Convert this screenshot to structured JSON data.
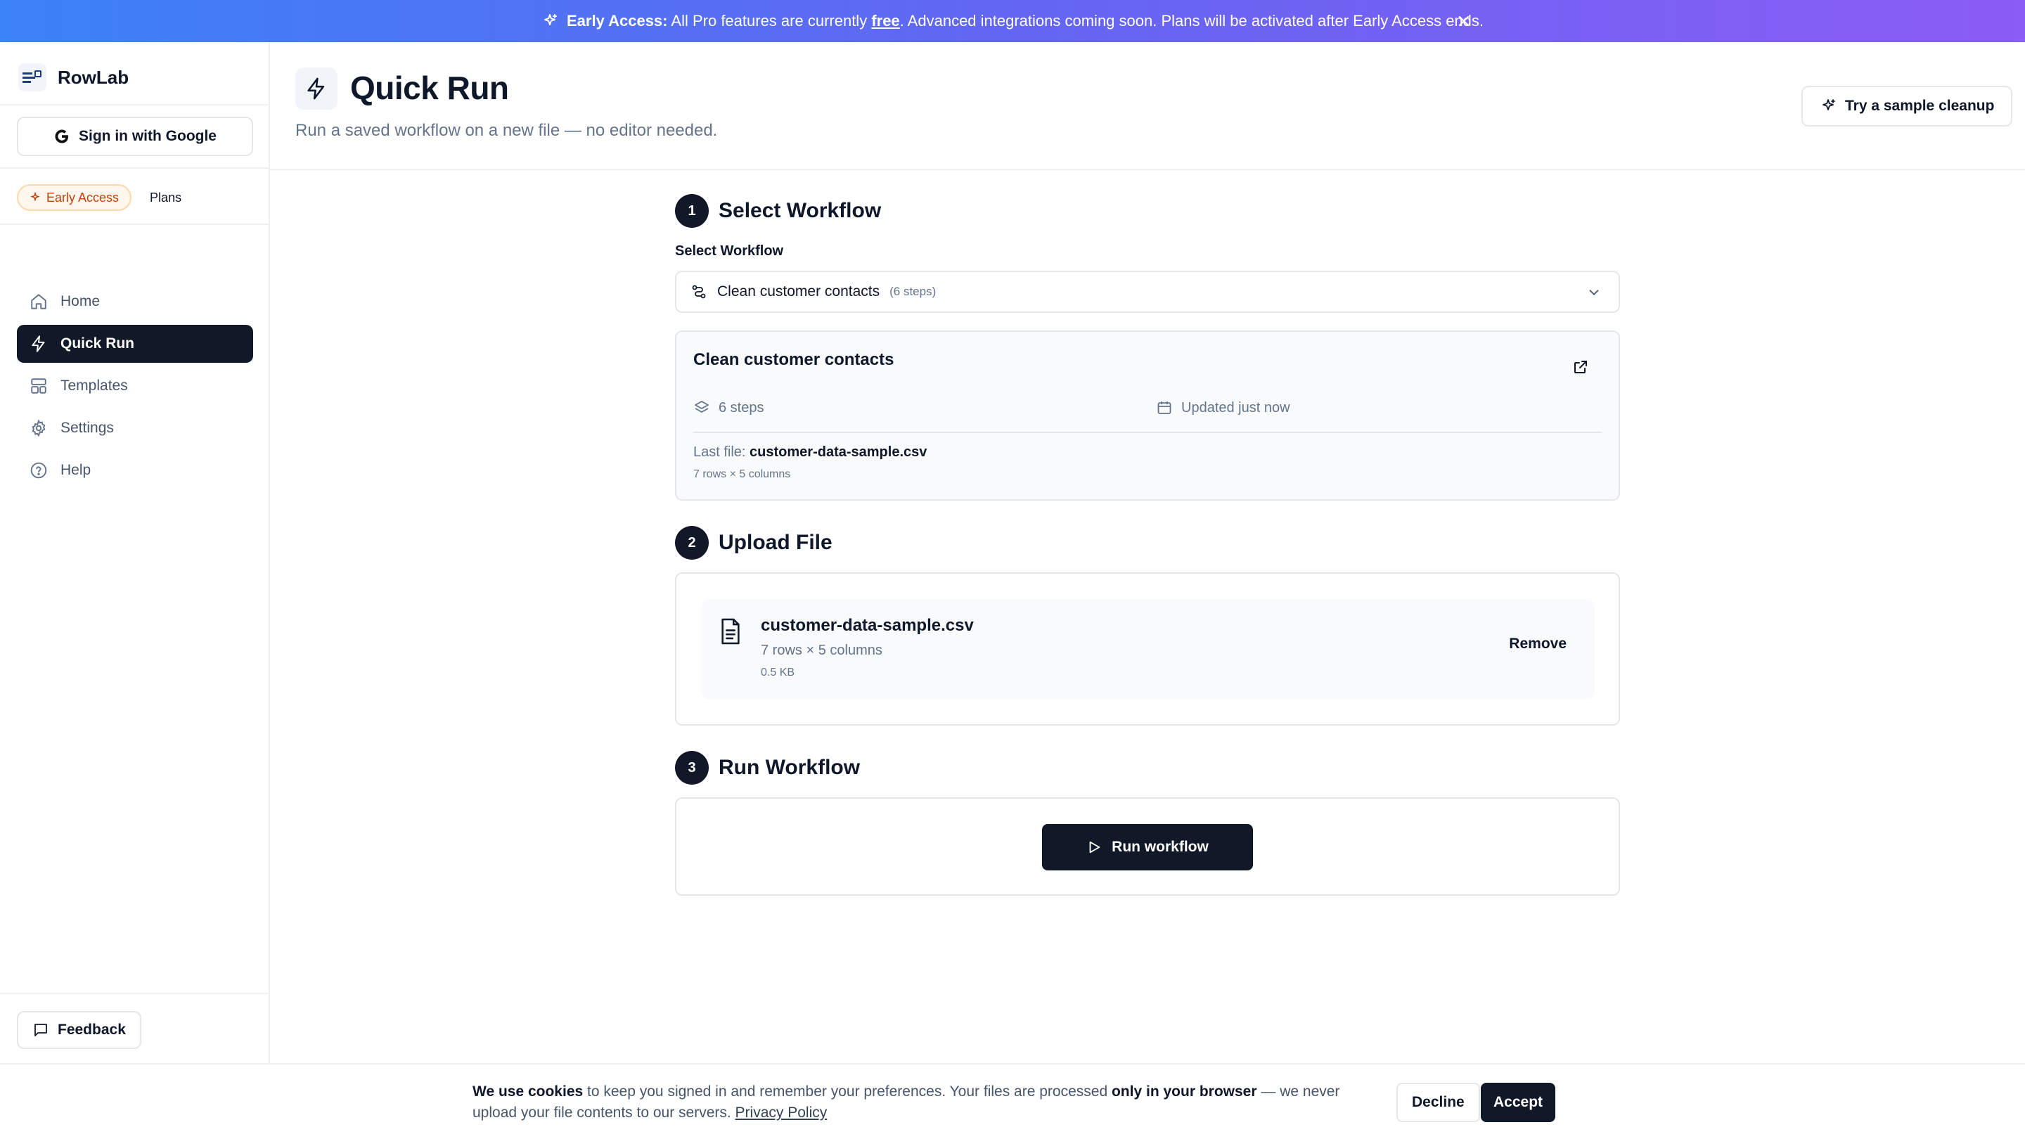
{
  "banner": {
    "lead": "Early Access:",
    "text_before": "All Pro features are currently",
    "free": "free",
    "text_after": ". Advanced integrations coming soon. Plans will be activated after Early Access ends."
  },
  "sidebar": {
    "app_name": "RowLab",
    "google_signin": "Sign in with Google",
    "early_access": "Early Access",
    "plans": "Plans",
    "items": [
      {
        "label": "Home",
        "icon": "home-icon"
      },
      {
        "label": "Quick Run",
        "icon": "bolt-icon",
        "active": true
      },
      {
        "label": "Templates",
        "icon": "layout-icon"
      },
      {
        "label": "Settings",
        "icon": "gear-icon"
      },
      {
        "label": "Help",
        "icon": "help-icon"
      }
    ],
    "feedback": "Feedback"
  },
  "header": {
    "title": "Quick Run",
    "subtitle": "Run a saved workflow on a new file — no editor needed.",
    "sample_button": "Try a sample cleanup"
  },
  "step1": {
    "number": "1",
    "title": "Select Workflow",
    "field_label": "Select Workflow",
    "selected": "Clean customer contacts",
    "selected_meta": "(6 steps)",
    "info": {
      "title": "Clean customer contacts",
      "steps": "6 steps",
      "updated": "Updated just now",
      "last_file_label": "Last file:",
      "last_file_name": "customer-data-sample.csv",
      "last_file_meta": "7 rows × 5 columns"
    }
  },
  "step2": {
    "number": "2",
    "title": "Upload File",
    "file_name": "customer-data-sample.csv",
    "file_dims": "7 rows × 5 columns",
    "file_size": "0.5 KB",
    "remove": "Remove"
  },
  "step3": {
    "number": "3",
    "title": "Run Workflow",
    "run_button": "Run workflow"
  },
  "cookie": {
    "we_use": "We use cookies",
    "text1": "to keep you signed in and remember your preferences. Your files are processed",
    "browser": "only in your browser",
    "text2": "— we never upload your file contents to our servers.",
    "privacy": "Privacy Policy",
    "decline": "Decline",
    "accept": "Accept"
  },
  "colors": {
    "primary": "#111827",
    "banner_start": "#3b82f6",
    "banner_end": "#8b5cf6",
    "early_access_accent": "#c2410c"
  }
}
